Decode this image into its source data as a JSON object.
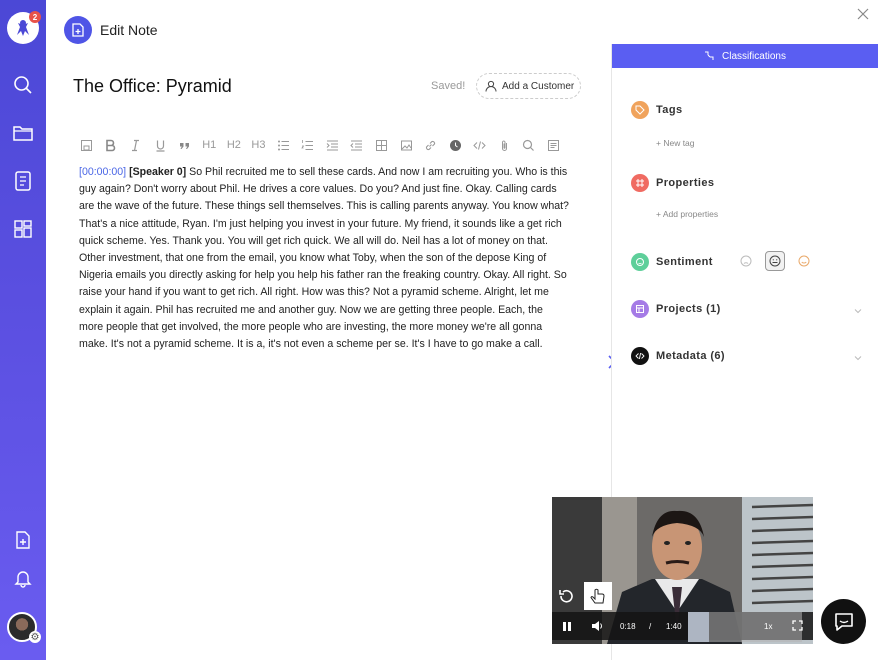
{
  "app": {
    "notification_count": "2"
  },
  "header": {
    "title": "Edit Note"
  },
  "note": {
    "title": "The Office: Pyramid",
    "save_status": "Saved!",
    "add_customer_label": "Add a Customer",
    "timestamp": "[00:00:00]",
    "speaker": "[Speaker 0]",
    "text": " So Phil recruited me to sell these cards. And now I am recruiting you. Who is this guy again? Don't worry about Phil. He drives a core values. Do you? And just fine. Okay. Calling cards are the wave of the future. These things sell themselves. This is calling parents anyway. You know what? That's a nice attitude, Ryan. I'm just helping you invest in your future. My friend, it sounds like a get rich quick scheme. Yes. Thank you. You will get rich quick. We all will do. Neil has a lot of money on that. Other investment, that one from the email, you know what Toby, when the son of the depose King of Nigeria emails you directly asking for help you help his father ran the freaking country. Okay. All right. So raise your hand if you want to get rich. All right. How was this? Not a pyramid scheme. Alright, let me explain it again. Phil has recruited me and another guy. Now we are getting three people. Each, the more people that get involved, the more people who are investing, the more money we're all gonna make. It's not a pyramid scheme. It is a, it's not even a scheme per se. It's I have to go make a call."
  },
  "toolbar": {
    "h1": "H1",
    "h2": "H2",
    "h3": "H3"
  },
  "panel": {
    "tab_label": "Classifications",
    "tags_label": "Tags",
    "new_tag": "+ New tag",
    "properties_label": "Properties",
    "add_properties": "+ Add properties",
    "sentiment_label": "Sentiment",
    "projects_label": "Projects (1)",
    "metadata_label": "Metadata (6)"
  },
  "video": {
    "current_time": "0:18",
    "separator": "/",
    "duration": "1:40",
    "speed": "1x",
    "progress": 0.18
  },
  "colors": {
    "accent": "#5a5ef2",
    "tags_icon": "#f0a35c",
    "properties_icon": "#f06b62",
    "sentiment_icon": "#5ecf9a",
    "projects_icon": "#a57be6",
    "metadata_icon": "#111111",
    "timestamp": "#4a66e6"
  }
}
